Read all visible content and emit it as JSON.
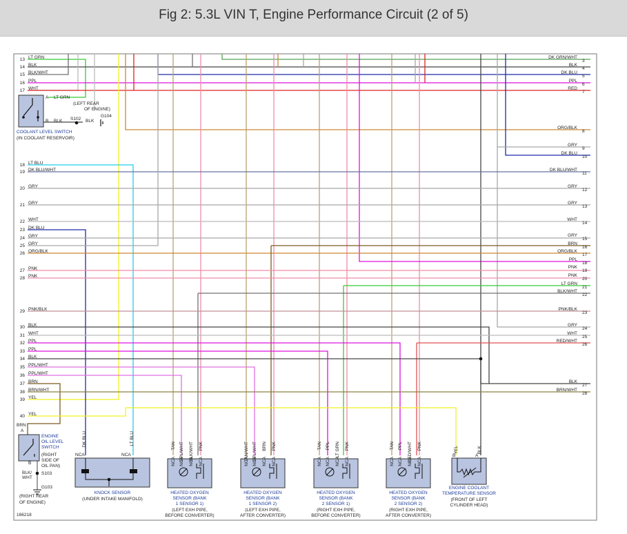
{
  "title": "Fig 2: 5.3L VIN T, Engine Performance Circuit (2 of 5)",
  "figure_id": "166218",
  "left_wires": [
    {
      "num": "13",
      "label": "LT GRN"
    },
    {
      "num": "14",
      "label": "BLK"
    },
    {
      "num": "15",
      "label": "BLK/WHT"
    },
    {
      "num": "16",
      "label": "PPL"
    },
    {
      "num": "17",
      "label": "WHT"
    },
    {
      "num": "18",
      "label": "LT BLU"
    },
    {
      "num": "19",
      "label": "DK BLU/WHT"
    },
    {
      "num": "20",
      "label": "GRY"
    },
    {
      "num": "21",
      "label": "GRY"
    },
    {
      "num": "22",
      "label": "WHT"
    },
    {
      "num": "23",
      "label": "DK BLU"
    },
    {
      "num": "24",
      "label": "GRY"
    },
    {
      "num": "25",
      "label": "GRY"
    },
    {
      "num": "26",
      "label": "ORG/BLK"
    },
    {
      "num": "27",
      "label": "PNK"
    },
    {
      "num": "28",
      "label": "PNK"
    },
    {
      "num": "29",
      "label": "PNK/BLK"
    },
    {
      "num": "30",
      "label": "BLK"
    },
    {
      "num": "31",
      "label": "WHT"
    },
    {
      "num": "32",
      "label": "PPL"
    },
    {
      "num": "33",
      "label": "PPL"
    },
    {
      "num": "34",
      "label": "BLK"
    },
    {
      "num": "35",
      "label": "PPL/WHT"
    },
    {
      "num": "36",
      "label": "PPL/WHT"
    },
    {
      "num": "37",
      "label": "BRN"
    },
    {
      "num": "38",
      "label": "BRN/WHT"
    },
    {
      "num": "39",
      "label": "YEL"
    },
    {
      "num": "40",
      "label": "YEL"
    }
  ],
  "right_wires": [
    {
      "num": "3",
      "label": "DK GRN/WHT"
    },
    {
      "num": "4",
      "label": "BLK"
    },
    {
      "num": "5",
      "label": "DK BLU"
    },
    {
      "num": "6",
      "label": "PPL"
    },
    {
      "num": "7",
      "label": "RED"
    },
    {
      "num": "8",
      "label": "ORG/BLK"
    },
    {
      "num": "9",
      "label": "GRY"
    },
    {
      "num": "10",
      "label": "DK BLU"
    },
    {
      "num": "11",
      "label": "DK BLU/WHT"
    },
    {
      "num": "12",
      "label": "GRY"
    },
    {
      "num": "13",
      "label": "GRY"
    },
    {
      "num": "14",
      "label": "WHT"
    },
    {
      "num": "15",
      "label": "GRY"
    },
    {
      "num": "16",
      "label": "BRN"
    },
    {
      "num": "17",
      "label": "ORG/BLK"
    },
    {
      "num": "18",
      "label": "PPL"
    },
    {
      "num": "19",
      "label": "PNK"
    },
    {
      "num": "20",
      "label": "PNK"
    },
    {
      "num": "21",
      "label": "LT GRN"
    },
    {
      "num": "22",
      "label": "BLK/WHT"
    },
    {
      "num": "23",
      "label": "PNK/BLK"
    },
    {
      "num": "24",
      "label": "GRY"
    },
    {
      "num": "25",
      "label": "WHT"
    },
    {
      "num": "26",
      "label": "RED/WHT"
    },
    {
      "num": "27",
      "label": "BLK"
    },
    {
      "num": "28",
      "label": "BRN/WHT"
    }
  ],
  "coolant_switch": {
    "pin_a": "A",
    "pin_b": "B",
    "a_wire": "LT GRN",
    "b_wire": "BLK",
    "splice": "S102",
    "splice_wire": "BLK",
    "ground": "G104",
    "ground_note": "(LEFT REAR OF ENGINE)",
    "name": "COOLANT LEVEL SWITCH",
    "location": "(IN COOLANT RESERVOIR)"
  },
  "oil_switch": {
    "wire_a": "BRN",
    "pin_a": "A",
    "pin_b": "B",
    "wire_b": "BLK/ WHT",
    "name": "ENGINE OIL LEVEL SWITCH",
    "location": "(RIGHT SIDE OF OIL PAN)",
    "splice": "S103",
    "ground": "G103",
    "ground_note": "(RIGHT REAR OF ENGINE)"
  },
  "knock_sensor": {
    "name": "KNOCK SENSOR",
    "location": "(UNDER INTAKE MANIFOLD)",
    "wire_left": "DK BLU",
    "wire_right": "LT BLU",
    "nca": "NCA"
  },
  "o2_sensors": [
    {
      "name": "HEATED OXYGEN SENSOR (BANK 1 SENSOR 1)",
      "location": "(LEFT EXH PIPE, BEFORE CONVERTER)",
      "wires": [
        "TAN",
        "PPL/WHT",
        "BLK/WHT",
        "PNK"
      ]
    },
    {
      "name": "HEATED OXYGEN SENSOR (BANK 1 SENSOR 2)",
      "location": "(LEFT EXH PIPE, AFTER CONVERTER)",
      "wires": [
        "TAN/WHT",
        "PPL/WHT",
        "BRN",
        "PNK"
      ]
    },
    {
      "name": "HEATED OXYGEN SENSOR (BANK 2 SENSOR 1)",
      "location": "(RIGHT EXH PIPE, BEFORE CONVERTER)",
      "wires": [
        "TAN",
        "PPL",
        "LT GRN",
        "PNK"
      ]
    },
    {
      "name": "HEATED OXYGEN SENSOR (BANK 2 SENSOR 2)",
      "location": "(RIGHT EXH PIPE, AFTER CONVERTER)",
      "wires": [
        "TAN",
        "PPL",
        "RED/WHT",
        "PNK"
      ]
    }
  ],
  "ect_sensor": {
    "name": "ENGINE COOLANT TEMPERATURE SENSOR",
    "location": "(FRONT OF LEFT CYLINDER HEAD)",
    "pin_b": "B",
    "pin_a": "A",
    "wire_b": "YEL",
    "wire_a": "BLK"
  },
  "colors": {
    "ltgrn": "#33cc33",
    "blk": "#444444",
    "blkwht": "#707070",
    "ppl": "#dd11dd",
    "wht": "#bbbbbb",
    "ltblu": "#22ccee",
    "dkbluwht": "#6670a0",
    "gry": "#a8a8a8",
    "dkblu": "#1a2aa8",
    "orgblk": "#cc8833",
    "pnk": "#f08aa8",
    "pnkblk": "#c09098",
    "pplwht": "#e070e0",
    "brn": "#7a5a20",
    "brnwht": "#8a8040",
    "yel": "#f0f022",
    "red": "#e02020",
    "redwht": "#e05050",
    "dkgrnwht": "#56a056",
    "tan": "#b8a070"
  }
}
